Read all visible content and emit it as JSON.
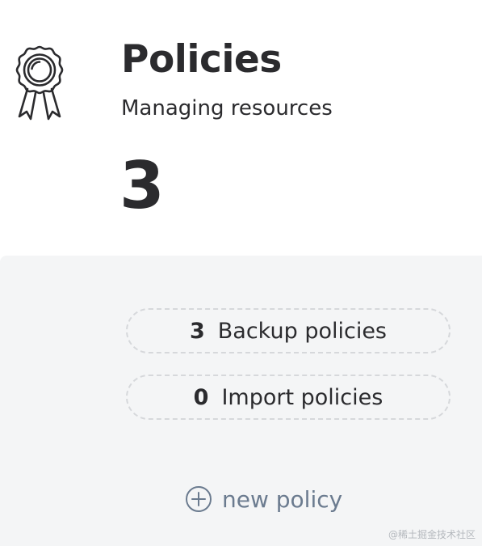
{
  "header": {
    "icon": "award-ribbon-icon",
    "title": "Policies",
    "subtitle": "Managing resources",
    "total": "3"
  },
  "policies": [
    {
      "count": "3",
      "label": "Backup policies"
    },
    {
      "count": "0",
      "label": "Import policies"
    }
  ],
  "actions": {
    "new_policy_icon": "plus-circle-icon",
    "new_policy_label": "new policy"
  },
  "watermark": "@稀土掘金技术社区",
  "colors": {
    "text": "#2b2b2e",
    "panel_bg": "#f4f5f6",
    "pill_border": "#d6d8db",
    "link": "#6b7b8f"
  }
}
